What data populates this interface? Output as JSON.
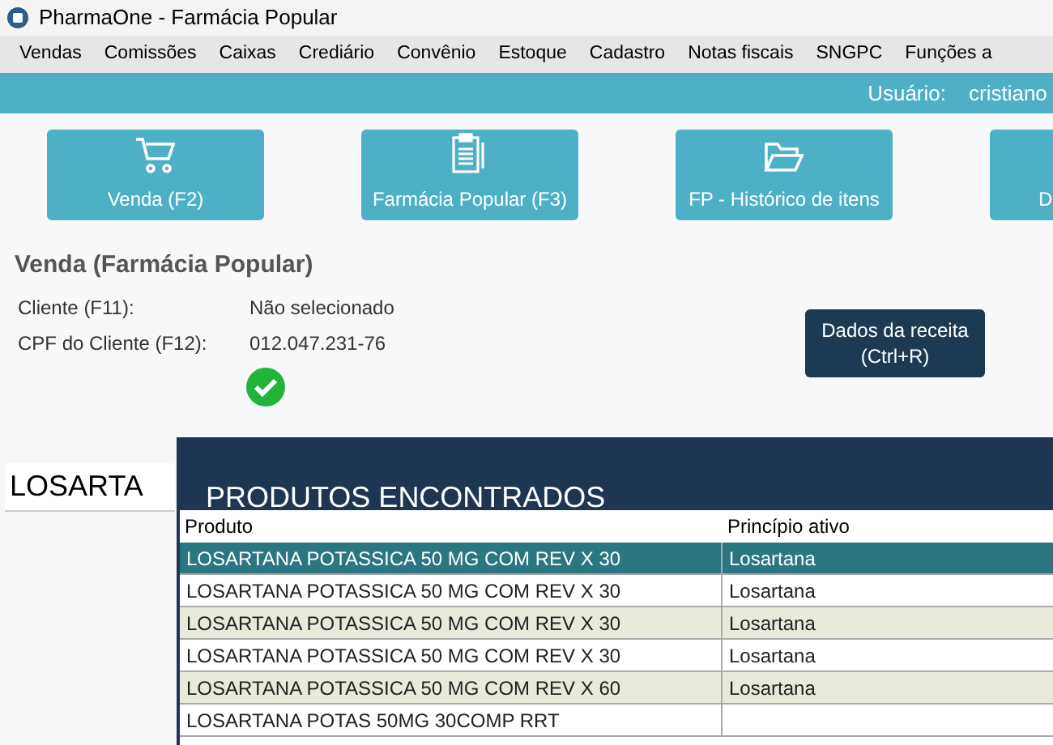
{
  "window": {
    "title": "PharmaOne - Farmácia Popular"
  },
  "menu": [
    "Vendas",
    "Comissões",
    "Caixas",
    "Crediário",
    "Convênio",
    "Estoque",
    "Cadastro",
    "Notas fiscais",
    "SNGPC",
    "Funções a"
  ],
  "user_bar": {
    "label": "Usuário:",
    "value": "cristiano"
  },
  "toolbar": [
    {
      "label": "Venda (F2)",
      "kind": "cart"
    },
    {
      "label": "Farmácia Popular (F3)",
      "kind": "clipboard"
    },
    {
      "label": "FP - Histórico de itens",
      "kind": "folder"
    },
    {
      "label": "D",
      "kind": "none"
    }
  ],
  "heading": "Venda (Farmácia Popular)",
  "client": [
    {
      "label": "Cliente (F11):",
      "value": "Não selecionado"
    },
    {
      "label": "CPF do Cliente (F12):",
      "value": "012.047.231-76"
    }
  ],
  "cpf_valid": true,
  "prescription_button": {
    "line1": "Dados da receita",
    "line2": "(Ctrl+R)"
  },
  "search": {
    "value": "LOSARTA"
  },
  "results": {
    "title": "PRODUTOS ENCONTRADOS",
    "columns": [
      "Produto",
      "Princípio ativo"
    ],
    "rows": [
      {
        "cells": [
          "LOSARTANA POTASSICA 50 MG COM REV X 30",
          "Losartana"
        ],
        "selected": true
      },
      {
        "cells": [
          "LOSARTANA POTASSICA 50 MG COM REV X 30",
          "Losartana"
        ],
        "selected": false
      },
      {
        "cells": [
          "LOSARTANA POTASSICA 50 MG COM REV X 30",
          "Losartana"
        ],
        "selected": false
      },
      {
        "cells": [
          "LOSARTANA POTASSICA 50 MG COM REV X 30",
          "Losartana"
        ],
        "selected": false
      },
      {
        "cells": [
          "LOSARTANA POTASSICA 50 MG COM REV X 60",
          "Losartana"
        ],
        "selected": false
      },
      {
        "cells": [
          "LOSARTANA POTAS 50MG 30COMP RRT",
          ""
        ],
        "selected": false
      }
    ]
  }
}
